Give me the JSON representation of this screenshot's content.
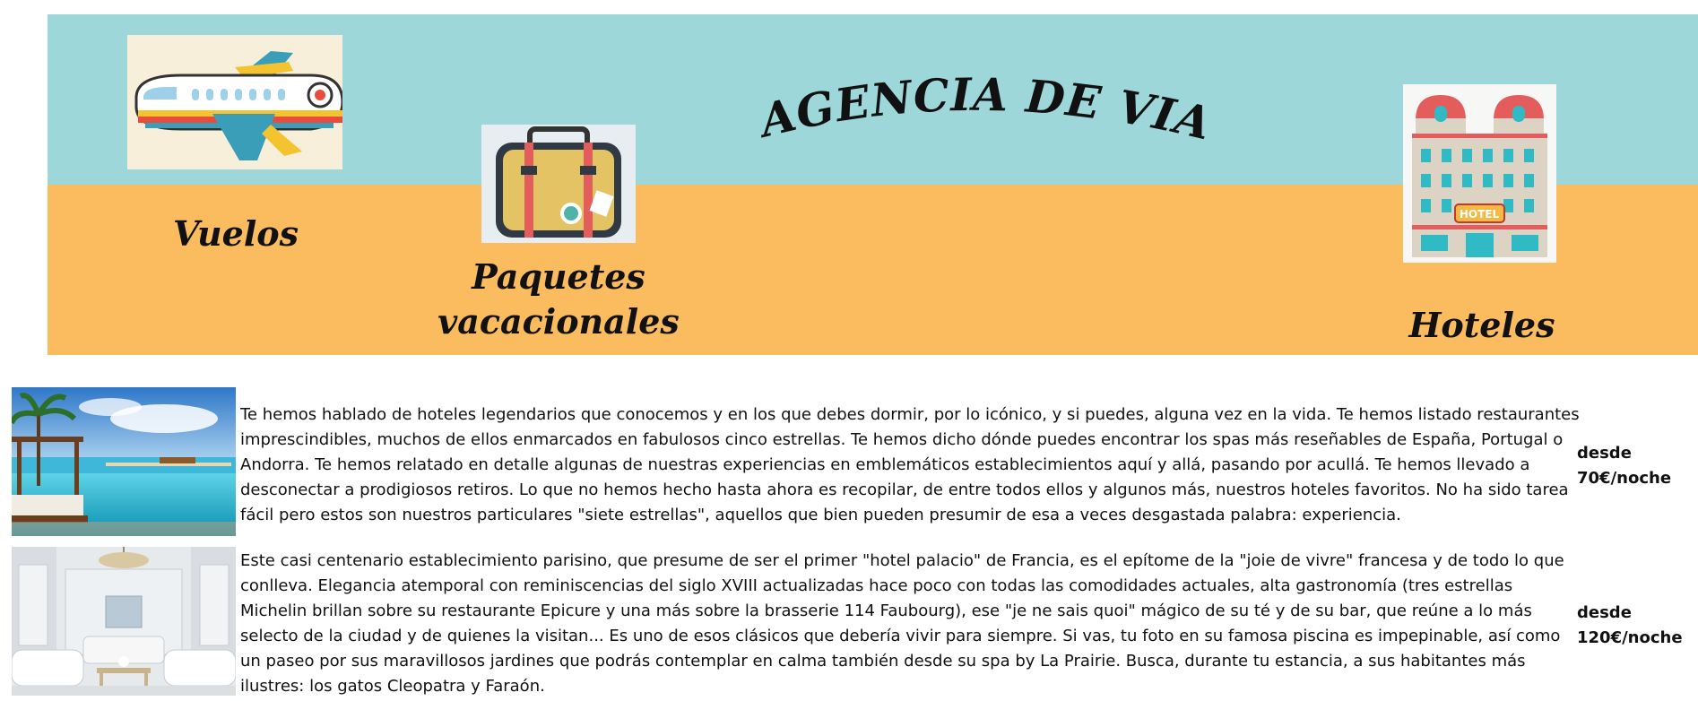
{
  "header": {
    "title": "AGENCIA DE VIAJES",
    "nav": [
      {
        "label": "Vuelos",
        "icon": "airplane-icon"
      },
      {
        "label": "Paquetes vacacionales",
        "icon": "suitcase-icon"
      },
      {
        "label": "Hoteles",
        "icon": "hotel-icon"
      }
    ],
    "colors": {
      "top_band": "#9dd7d9",
      "bottom_band": "#fbbb5f"
    }
  },
  "hotels": [
    {
      "image": "tropical-resort-pool-photo",
      "description": "Te hemos hablado de hoteles legendarios que conocemos y en los que debes dormir, por lo icónico, y si puedes, alguna vez en la vida. Te hemos listado restaurantes imprescindibles, muchos de ellos enmarcados en fabulosos cinco estrellas. Te hemos dicho dónde puedes encontrar los spas más reseñables de España, Portugal o Andorra. Te hemos relatado en detalle algunas de nuestras experiencias en emblemáticos establecimientos aquí y allá, pasando por acullá. Te hemos llevado a desconectar a prodigiosos retiros. Lo que no hemos hecho hasta ahora es recopilar, de entre todos ellos y algunos más, nuestros hoteles favoritos. No ha sido tarea fácil pero estos son nuestros particulares \"siete estrellas\", aquellos que bien pueden presumir de esa a veces desgastada palabra: experiencia.",
      "price_prefix": "desde",
      "price": "70€/noche"
    },
    {
      "image": "parisian-hotel-salon-photo",
      "description": "Este casi centenario establecimiento parisino, que presume de ser el primer \"hotel palacio\" de Francia, es el epítome de la \"joie de vivre\" francesa y de todo lo que conlleva. Elegancia atemporal con reminiscencias del siglo XVIII actualizadas hace poco con todas las comodidades actuales, alta gastronomía (tres estrellas Michelin brillan sobre su restaurante Epicure y una más sobre la brasserie 114 Faubourg), ese \"je ne sais quoi\" mágico de su té y de su bar, que reúne a lo más selecto de la ciudad y de quienes la visitan... Es uno de esos clásicos que debería vivir para siempre. Si vas, tu foto en su famosa piscina es impepinable, así como un paseo por sus maravillosos jardines que podrás contemplar en calma también desde su spa by La Prairie. Busca, durante tu estancia, a sus habitantes más ilustres: los gatos Cleopatra y Faraón.",
      "price_prefix": "desde",
      "price": "120€/noche"
    }
  ]
}
